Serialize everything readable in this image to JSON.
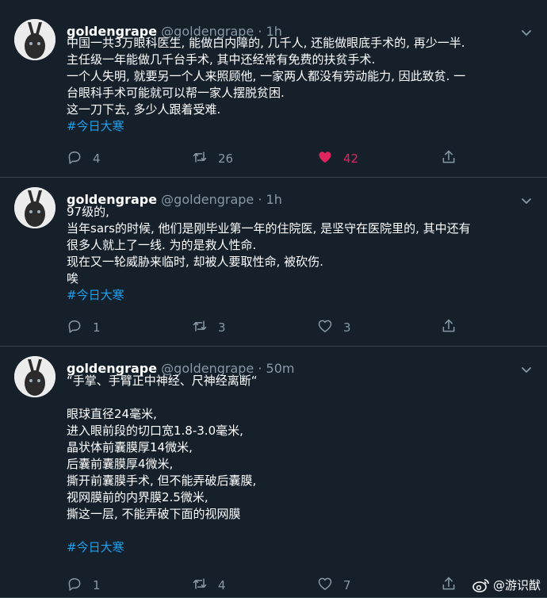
{
  "tweets": [
    {
      "name": "goldengrape",
      "handle": "@goldengrape",
      "separator": "·",
      "time": "1h",
      "lines": [
        "中国一共3万眼科医生, 能做白内障的, 几千人, 还能做眼底手术的, 再少一半.",
        "主任级一年能做几千台手术, 其中还经常有免费的扶贫手术.",
        "一个人失明, 就要另一个人来照顾他, 一家两人都没有劳动能力, 因此致贫. 一",
        "台眼科手术可能就可以帮一家人摆脱贫困.",
        "这一刀下去, 多少人跟着受难."
      ],
      "hashtag": "#今日大寒",
      "reply_count": "4",
      "retweet_count": "26",
      "like_count": "42",
      "liked": true
    },
    {
      "name": "goldengrape",
      "handle": "@goldengrape",
      "separator": "·",
      "time": "1h",
      "lines": [
        "97级的,",
        "当年sars的时候, 他们是刚毕业第一年的住院医, 是坚守在医院里的, 其中还有",
        "很多人就上了一线. 为的是救人性命.",
        "现在又一轮威胁来临时, 却被人要取性命, 被砍伤.",
        "唉"
      ],
      "hashtag": "#今日大寒",
      "reply_count": "1",
      "retweet_count": "3",
      "like_count": "3",
      "liked": false
    },
    {
      "name": "goldengrape",
      "handle": "@goldengrape",
      "separator": "·",
      "time": "50m",
      "lines": [
        "“手掌、手臂正中神经、尺神经离断“",
        "",
        "眼球直径24毫米,",
        "进入眼前段的切口宽1.8-3.0毫米,",
        "晶状体前囊膜厚14微米,",
        "后囊前囊膜厚4微米,",
        "撕开前囊膜手术, 但不能弄破后囊膜,",
        "视网膜前的内界膜2.5微米,",
        "撕这一层, 不能弄破下面的视网膜",
        ""
      ],
      "hashtag": "#今日大寒",
      "reply_count": "1",
      "retweet_count": "4",
      "like_count": "7",
      "liked": false
    }
  ],
  "watermark": {
    "text": "@游识猷",
    "icon": "weibo-icon"
  },
  "colors": {
    "background": "#15202b",
    "secondary_text": "#8899a6",
    "link": "#1da1f2",
    "like_active": "#e0245e",
    "divider": "#38444d"
  }
}
